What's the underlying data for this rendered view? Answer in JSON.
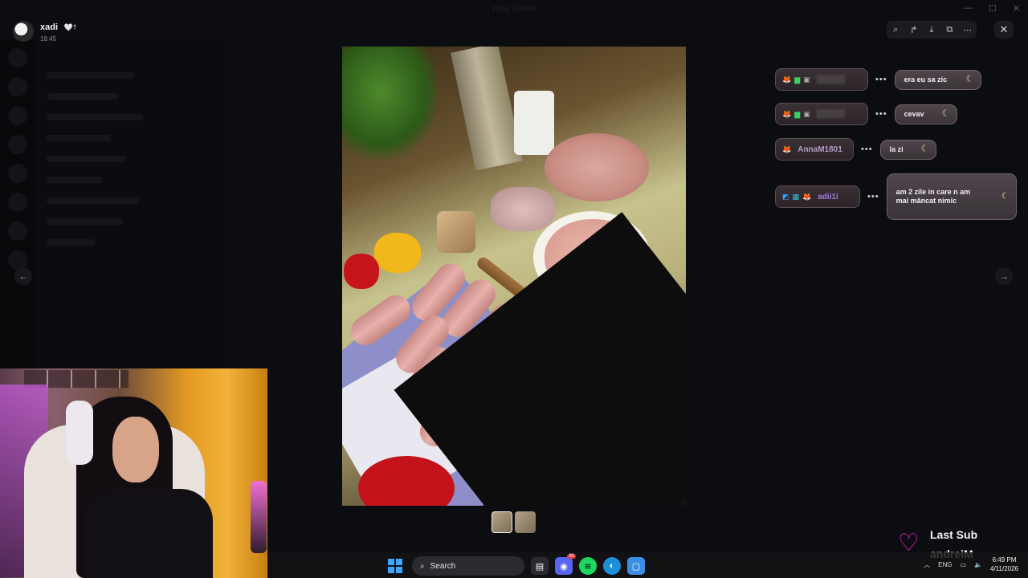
{
  "window": {
    "title": "Yass Server",
    "controls": {
      "minimize": "—",
      "maximize": "☐",
      "close": "✕"
    }
  },
  "uploader": {
    "name": "xadi",
    "badges": "🤍☨",
    "time": "18:45"
  },
  "viewer": {
    "toolbar_icons": [
      "zoom-icon",
      "forward-icon",
      "download-icon",
      "open-external-icon",
      "more-icon"
    ],
    "toolbar_glyphs": [
      "⌕",
      "↱",
      "⤓",
      "⧉",
      "⋯"
    ],
    "close_glyph": "✕",
    "prev_glyph": "←",
    "next_glyph": "→",
    "thumbnail_count": 2,
    "active_thumbnail": 1
  },
  "chat": {
    "messages": [
      {
        "user": "",
        "text": "era eu sa zic"
      },
      {
        "user": "",
        "text": "cevav"
      },
      {
        "user": "AnnaM1801",
        "text": "la zi"
      },
      {
        "user": "adii1i",
        "text": "am 2 zile in care n am\nmai mâncat nimic"
      }
    ]
  },
  "last_sub": {
    "title": "Last Sub",
    "name": "andreiM"
  },
  "taskbar": {
    "search_placeholder": "Search",
    "language": "ENG",
    "time": "6:49 PM",
    "date": "4/11/2026",
    "discord_badge": "30"
  },
  "colors": {
    "accent_heart": "#e021c8",
    "windows_blue": "#3ba7ff",
    "spotify_green": "#1ed760",
    "chat_name_purple": "#b69cc4"
  }
}
